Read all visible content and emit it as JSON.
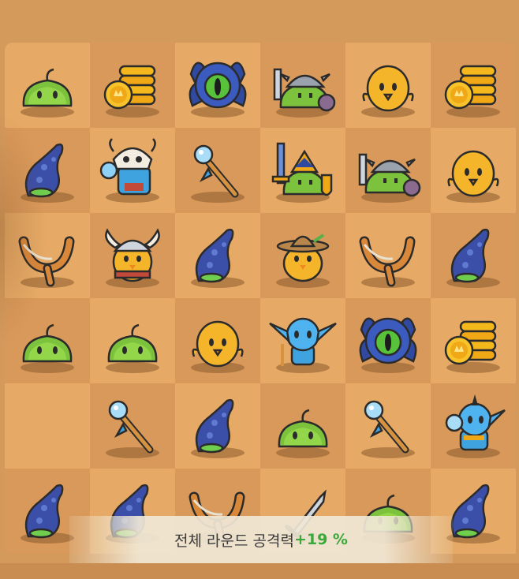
{
  "board": {
    "rows": [
      [
        "green-slime-icon",
        "gold-coin-stack-icon",
        "blue-spider-eye-icon",
        "viking-slime-icon",
        "yellow-chick-icon",
        "gold-coin-stack-icon"
      ],
      [
        "blue-tentacle-icon",
        "skull-shaman-icon",
        "magic-wand-icon",
        "armored-knight-slime-icon",
        "viking-slime-icon",
        "yellow-chick-icon"
      ],
      [
        "slingshot-icon",
        "viking-chick-icon",
        "blue-tentacle-icon",
        "cowboy-chick-icon",
        "slingshot-icon",
        "blue-tentacle-icon"
      ],
      [
        "green-slime-icon",
        "green-slime-icon",
        "yellow-chick-icon",
        "blue-goblin-icon",
        "blue-spider-eye-icon",
        "gold-coin-stack-icon"
      ],
      [
        "empty",
        "magic-wand-icon",
        "blue-tentacle-icon",
        "green-slime-icon",
        "magic-wand-icon",
        "goblin-chief-icon"
      ],
      [
        "blue-tentacle-icon",
        "blue-tentacle-icon",
        "slingshot-icon",
        "sword-icon",
        "green-slime-icon",
        "blue-tentacle-icon"
      ]
    ],
    "colors": {
      "light_tile": "#e6aa66",
      "dark_tile": "#d9995a"
    }
  },
  "toast": {
    "text": "전체 라운드 공격력",
    "value": "+19 %",
    "value_color": "#3aa83a"
  }
}
